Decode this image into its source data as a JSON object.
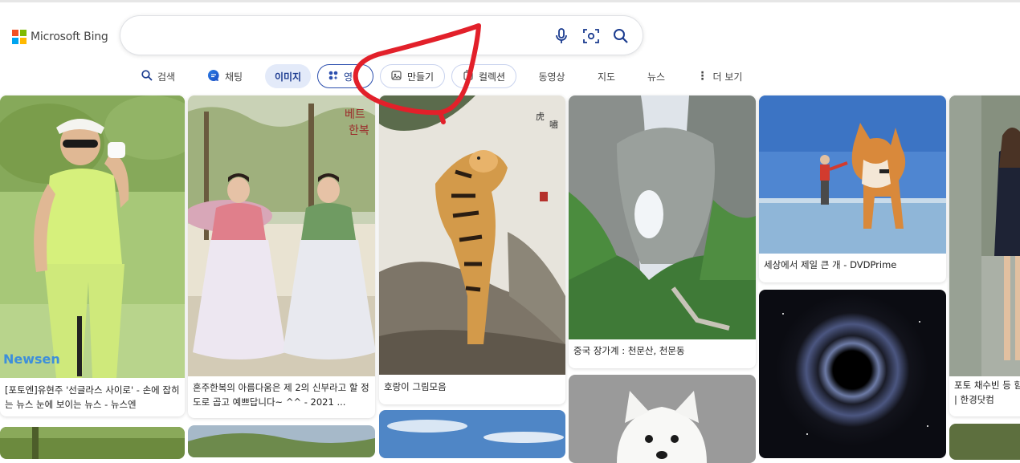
{
  "brand": {
    "name": "Microsoft Bing",
    "colors": [
      "#f25022",
      "#7fba00",
      "#00a4ef",
      "#ffb900"
    ]
  },
  "search": {
    "value": "",
    "placeholder": "",
    "icons": [
      "microphone-icon",
      "visual-search-icon",
      "search-icon"
    ]
  },
  "tabs": [
    {
      "label": "검색",
      "icon": "search-icon"
    },
    {
      "label": "채팅",
      "icon": "chat-bubble-icon"
    },
    {
      "label": "이미지",
      "active": true
    },
    {
      "label": "영",
      "icon": "sparkle-icon"
    },
    {
      "label": "만들기",
      "icon": "create-image-icon"
    },
    {
      "label": "컬렉션",
      "icon": "collection-icon"
    },
    {
      "label": "동영상"
    },
    {
      "label": "지도"
    },
    {
      "label": "뉴스"
    },
    {
      "label": "더 보기",
      "icon": "more-vertical-icon"
    }
  ],
  "results": [
    {
      "caption": "[포토엔]유현주 '선글라스 사이로' - 손에 잡히는 뉴스 눈에 보이는 뉴스 - 뉴스엔",
      "watermark": "Newsen"
    },
    {
      "caption": "혼주한복의 아름다움은 제 2의 신부라고 할 정도로 곱고 예쁘답니다~ ^^ - 2021 ..."
    },
    {
      "caption": "호랑이 그림모음"
    },
    {
      "caption": "중국 장가계 : 천문산, 천문동"
    },
    {
      "caption": "세상에서 제일 큰 개 - DVDPrime"
    },
    {
      "caption": "포토 채수빈 등 함 | 한경닷컴"
    }
  ],
  "annotation_color": "#e2202a"
}
